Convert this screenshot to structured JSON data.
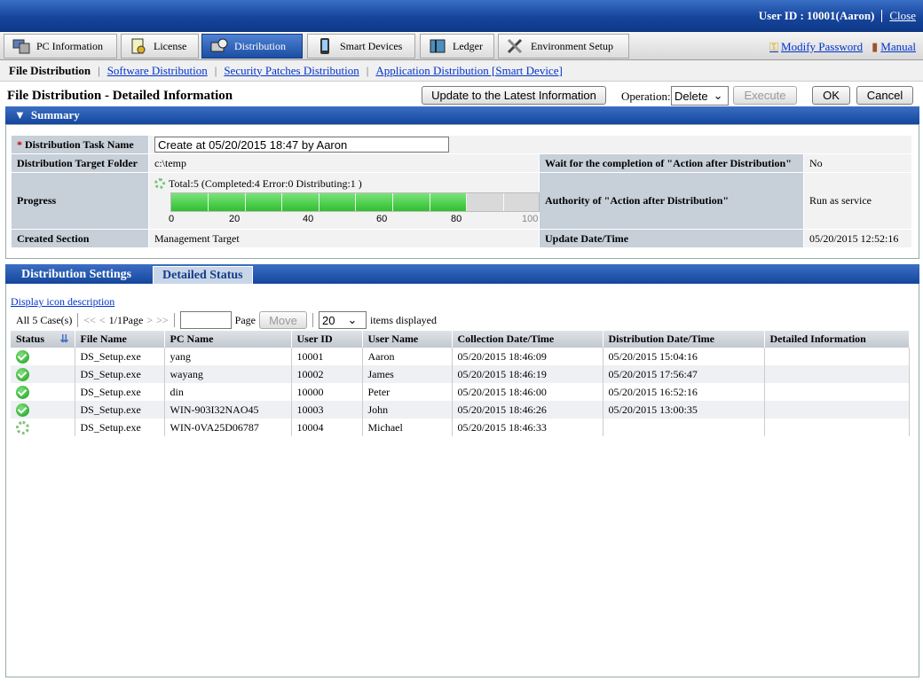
{
  "user": {
    "label": "User ID : 10001(Aaron)",
    "close": "Close"
  },
  "nav": {
    "tabs": [
      {
        "label": "PC Information",
        "icon": "pc-icon"
      },
      {
        "label": "License",
        "icon": "license-icon"
      },
      {
        "label": "Distribution",
        "icon": "distribution-icon"
      },
      {
        "label": "Smart Devices",
        "icon": "phone-icon"
      },
      {
        "label": "Ledger",
        "icon": "ledger-icon"
      },
      {
        "label": "Environment Setup",
        "icon": "tools-icon"
      }
    ],
    "modify_password": "Modify Password",
    "manual": "Manual"
  },
  "subnav": {
    "current": "File Distribution",
    "links": [
      "Software Distribution",
      "Security Patches Distribution",
      "Application Distribution [Smart Device]"
    ]
  },
  "page": {
    "title": "File Distribution - Detailed Information",
    "update_button": "Update to the Latest Information",
    "operation_label": "Operation:",
    "operation_value": "Delete",
    "execute": "Execute",
    "ok": "OK",
    "cancel": "Cancel"
  },
  "summary": {
    "header": "Summary",
    "task_name_label": "Distribution Task Name",
    "task_name_value": "Create at 05/20/2015 18:47 by Aaron",
    "target_folder_label": "Distribution Target Folder",
    "target_folder_value": "c:\\temp",
    "wait_label": "Wait for the completion of \"Action after Distribution\"",
    "wait_value": "No",
    "progress_label": "Progress",
    "progress_text": "Total:5  (Completed:4  Error:0  Distributing:1 )",
    "progress_percent": 80,
    "progress_scale": [
      "0",
      "20",
      "40",
      "60",
      "80",
      "100"
    ],
    "authority_label": "Authority of \"Action after Distribution\"",
    "authority_value": "Run as service",
    "created_label": "Created Section",
    "created_value": "Management Target",
    "update_label": "Update Date/Time",
    "update_value": "05/20/2015 12:52:16"
  },
  "tabs": {
    "settings": "Distribution Settings",
    "status": "Detailed Status"
  },
  "status": {
    "icon_link": "Display icon description",
    "case_count": "All 5 Case(s)",
    "first": "<<",
    "prev": "<",
    "page_info": "1/1Page",
    "next": ">",
    "last": ">>",
    "page_label": "Page",
    "move": "Move",
    "per_page": "20",
    "items_displayed": "items displayed",
    "columns": [
      "Status",
      "File Name",
      "PC Name",
      "User ID",
      "User Name",
      "Collection Date/Time",
      "Distribution Date/Time",
      "Detailed Information"
    ],
    "rows": [
      {
        "status": "completed",
        "file": "DS_Setup.exe",
        "pc": "yang",
        "uid": "10001",
        "user": "Aaron",
        "collect": "05/20/2015 18:46:09",
        "dist": "05/20/2015 15:04:16",
        "detail": ""
      },
      {
        "status": "completed",
        "file": "DS_Setup.exe",
        "pc": "wayang",
        "uid": "10002",
        "user": "James",
        "collect": "05/20/2015 18:46:19",
        "dist": "05/20/2015 17:56:47",
        "detail": ""
      },
      {
        "status": "completed",
        "file": "DS_Setup.exe",
        "pc": "din",
        "uid": "10000",
        "user": "Peter",
        "collect": "05/20/2015 18:46:00",
        "dist": "05/20/2015 16:52:16",
        "detail": ""
      },
      {
        "status": "completed",
        "file": "DS_Setup.exe",
        "pc": "WIN-903I32NAO45",
        "uid": "10003",
        "user": "John",
        "collect": "05/20/2015 18:46:26",
        "dist": "05/20/2015 13:00:35",
        "detail": ""
      },
      {
        "status": "distributing",
        "file": "DS_Setup.exe",
        "pc": "WIN-0VA25D06787",
        "uid": "10004",
        "user": "Michael",
        "collect": "05/20/2015 18:46:33",
        "dist": "",
        "detail": ""
      }
    ]
  }
}
